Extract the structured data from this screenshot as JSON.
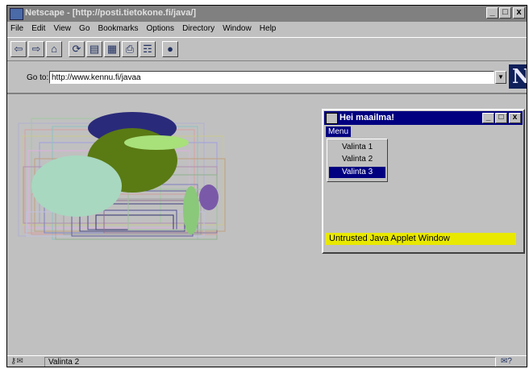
{
  "window": {
    "title": "Netscape - [http://posti.tietokone.fi/java/]",
    "controls": [
      "_",
      "□",
      "x"
    ]
  },
  "menubar": [
    "File",
    "Edit",
    "View",
    "Go",
    "Bookmarks",
    "Options",
    "Directory",
    "Window",
    "Help"
  ],
  "toolbar": {
    "buttons": [
      "back-icon",
      "forward-icon",
      "home-icon",
      "reload-icon",
      "images-icon",
      "open-icon",
      "print-icon",
      "find-icon",
      "stop-icon"
    ]
  },
  "location": {
    "label": "Go to:",
    "url": "http://www.kennu.fi/javaa"
  },
  "logo": "N",
  "applet": {
    "title": "Hei maailma!",
    "menu_label": "Menu",
    "items": [
      "Valinta 1",
      "Valinta 2",
      "Valinta 3"
    ],
    "selected_item": "Valinta 3",
    "warning": "Untrusted Java Applet Window"
  },
  "status": {
    "text": "Valinta 2"
  },
  "colors": {
    "title_inactive": "#808080",
    "applet_title": "#000080",
    "warning_bg": "#e8e800",
    "shape_navy": "#2a2a7a",
    "shape_olive": "#5a7a14",
    "shape_mint": "#a8d8c0",
    "shape_lightgreen": "#a8e07a",
    "shape_purple": "#7a5aa8"
  }
}
